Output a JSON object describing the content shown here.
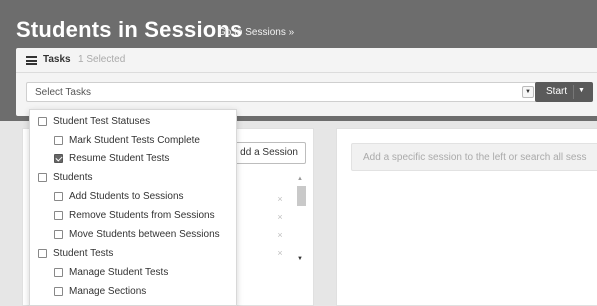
{
  "header": {
    "title": "Students in Sessions",
    "goto_link": "Go to Sessions »"
  },
  "tasks": {
    "label": "Tasks",
    "selected_count": "1 Selected",
    "select_placeholder": "Select Tasks",
    "start_label": "Start"
  },
  "left_panel": {
    "add_session_label": "dd a Session",
    "remove_icon": "×"
  },
  "right_panel": {
    "search_hint": "Add a specific session to the left or search all sess"
  },
  "dropdown": {
    "groups": [
      {
        "label": "Student Test Statuses",
        "checked": false,
        "items": [
          {
            "label": "Mark Student Tests Complete",
            "checked": false
          },
          {
            "label": "Resume Student Tests",
            "checked": true
          }
        ]
      },
      {
        "label": "Students",
        "checked": false,
        "items": [
          {
            "label": "Add Students to Sessions",
            "checked": false
          },
          {
            "label": "Remove Students from Sessions",
            "checked": false
          },
          {
            "label": "Move Students between Sessions",
            "checked": false
          }
        ]
      },
      {
        "label": "Student Tests",
        "checked": false,
        "items": [
          {
            "label": "Manage Student Tests",
            "checked": false
          },
          {
            "label": "Manage Sections",
            "checked": false
          }
        ]
      }
    ]
  },
  "colors": {
    "header_bg": "#6d6d6d",
    "start_button_bg": "#5a5a5a",
    "checked_box": "#666666"
  }
}
